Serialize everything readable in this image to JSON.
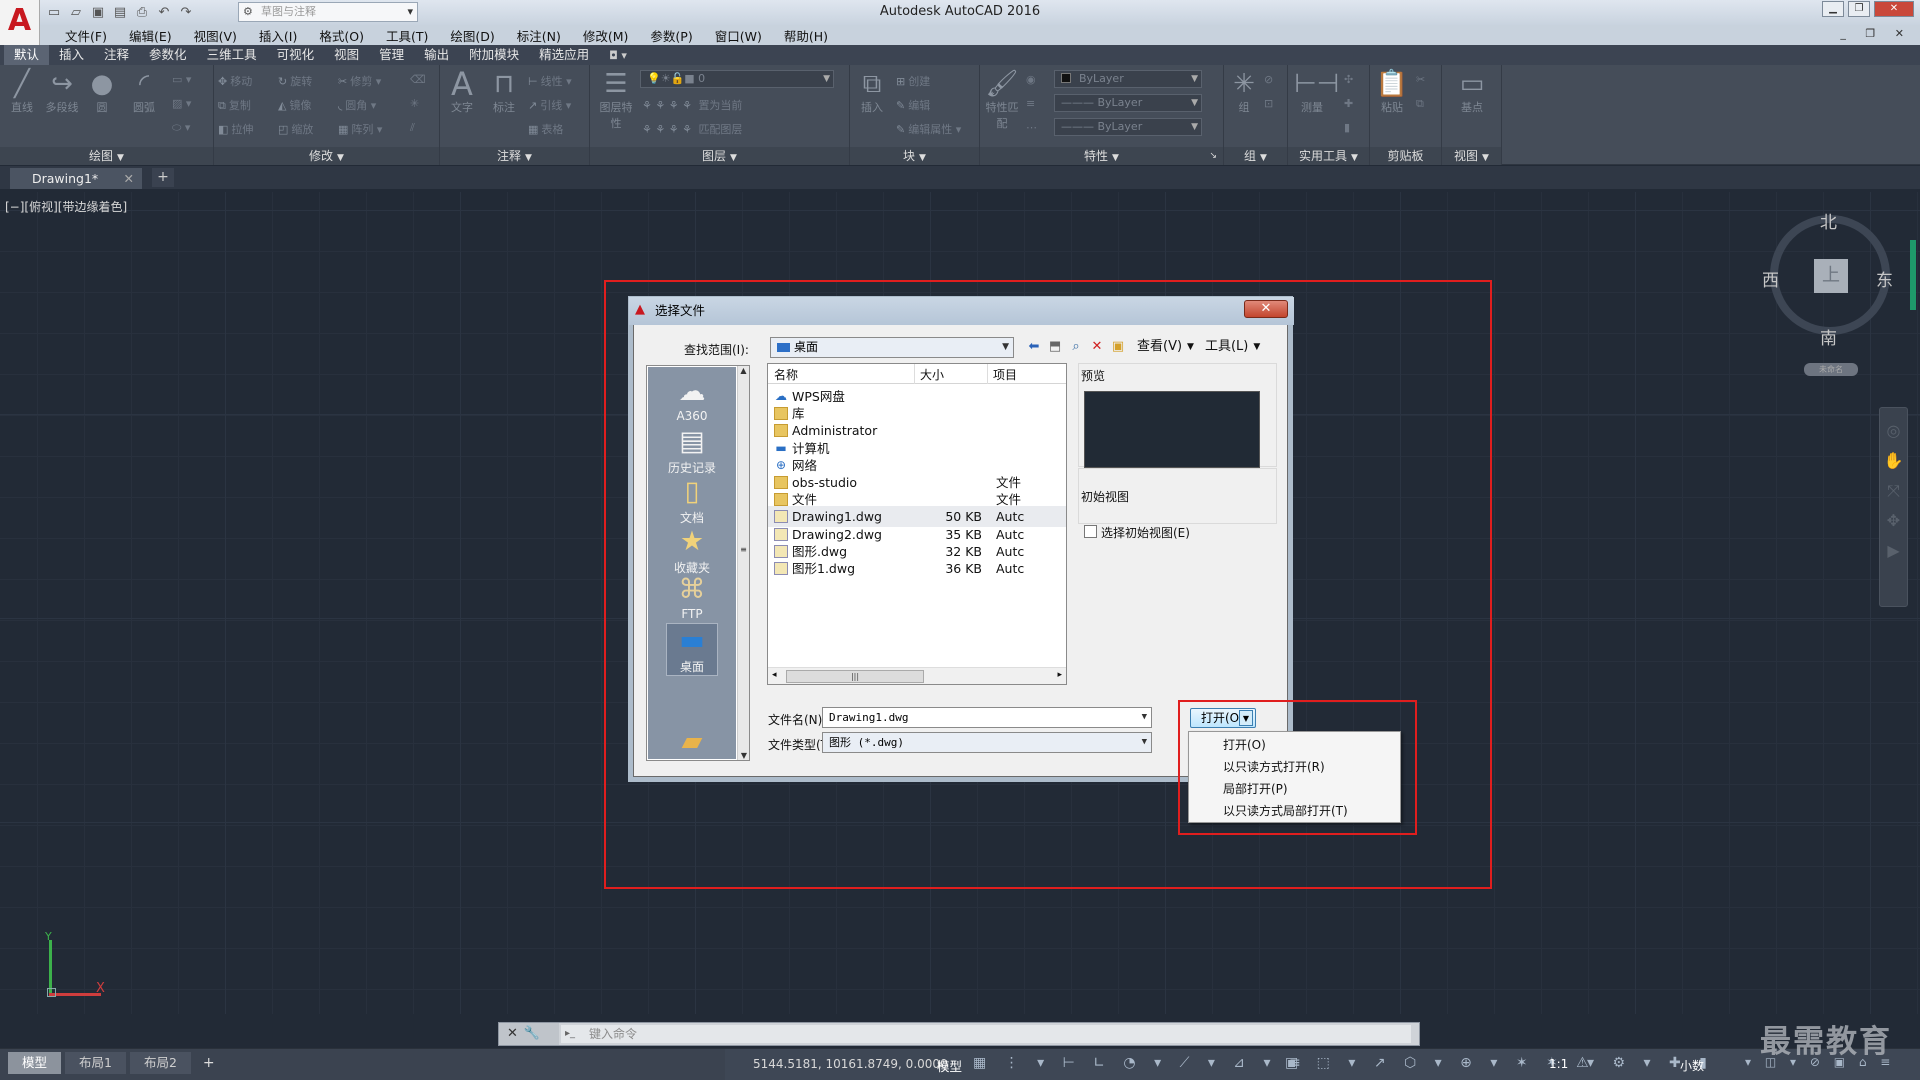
{
  "app": {
    "title": "Autodesk AutoCAD 2016",
    "workspace": "草图与注释",
    "logo_letter": "A"
  },
  "menus": [
    "文件(F)",
    "编辑(E)",
    "视图(V)",
    "插入(I)",
    "格式(O)",
    "工具(T)",
    "绘图(D)",
    "标注(N)",
    "修改(M)",
    "参数(P)",
    "窗口(W)",
    "帮助(H)"
  ],
  "ribbon_tabs": [
    "默认",
    "插入",
    "注释",
    "参数化",
    "三维工具",
    "可视化",
    "视图",
    "管理",
    "输出",
    "附加模块",
    "精选应用"
  ],
  "ribbon": {
    "panels": [
      "绘图",
      "修改",
      "注释",
      "图层",
      "块",
      "特性",
      "组",
      "实用工具",
      "剪贴板",
      "视图"
    ],
    "draw_tools": [
      "直线",
      "多段线",
      "圆",
      "圆弧"
    ],
    "modify_tools": [
      "移动",
      "旋转",
      "修剪",
      "复制",
      "镜像",
      "圆角",
      "拉伸",
      "缩放",
      "阵列"
    ],
    "annot_tools": [
      "文字",
      "标注",
      "线性",
      "引线",
      "表格"
    ],
    "layer_tools": [
      "图层特性",
      "置为当前",
      "匹配图层"
    ],
    "layer_current": "0",
    "block_tools": [
      "插入",
      "创建",
      "编辑",
      "编辑属性"
    ],
    "prop_tools": [
      "特性匹配"
    ],
    "bylayer": [
      "ByLayer",
      "ByLayer",
      "ByLayer"
    ],
    "util_tools": [
      "测量"
    ],
    "clip_tools": [
      "粘贴"
    ],
    "view_tools": [
      "基点"
    ]
  },
  "document": {
    "tab": "Drawing1*",
    "view_label": "[−][俯视][带边缘着色]"
  },
  "viewcube": {
    "north": "北",
    "south": "南",
    "east": "东",
    "west": "西",
    "face": "上",
    "ucs_name": "未命名"
  },
  "dialog": {
    "title": "选择文件",
    "look_in_label": "查找范围(I):",
    "look_in_value": "桌面",
    "views_label": "查看(V)",
    "tools_label": "工具(L)",
    "places": [
      "A360",
      "历史记录",
      "文档",
      "收藏夹",
      "FTP",
      "桌面"
    ],
    "columns": {
      "name": "名称",
      "size": "大小",
      "type": "项目"
    },
    "files": [
      {
        "name": "WPS网盘",
        "size": "",
        "type": "",
        "kind": "cloud"
      },
      {
        "name": "库",
        "size": "",
        "type": "",
        "kind": "folder"
      },
      {
        "name": "Administrator",
        "size": "",
        "type": "",
        "kind": "folder"
      },
      {
        "name": "计算机",
        "size": "",
        "type": "",
        "kind": "computer"
      },
      {
        "name": "网络",
        "size": "",
        "type": "",
        "kind": "network"
      },
      {
        "name": "obs-studio",
        "size": "",
        "type": "文件",
        "kind": "folder"
      },
      {
        "name": "文件",
        "size": "",
        "type": "文件",
        "kind": "folder"
      },
      {
        "name": "Drawing1.dwg",
        "size": "50 KB",
        "type": "Autc",
        "kind": "dwg"
      },
      {
        "name": "Drawing2.dwg",
        "size": "35 KB",
        "type": "Autc",
        "kind": "dwg"
      },
      {
        "name": "图形.dwg",
        "size": "32 KB",
        "type": "Autc",
        "kind": "dwg"
      },
      {
        "name": "图形1.dwg",
        "size": "36 KB",
        "type": "Autc",
        "kind": "dwg"
      }
    ],
    "selected_index": 7,
    "preview_label": "预览",
    "initial_view_label": "初始视图",
    "select_initial_view": "选择初始视图(E)",
    "file_name_label": "文件名(N):",
    "file_name_value": "Drawing1.dwg",
    "file_type_label": "文件类型(T):",
    "file_type_value": "图形 (*.dwg)",
    "open_button": "打开(O)",
    "close_glyph": "✕"
  },
  "open_menu": [
    "打开(O)",
    "以只读方式打开(R)",
    "局部打开(P)",
    "以只读方式局部打开(T)"
  ],
  "command_line": {
    "placeholder": "键入命令"
  },
  "ucs": {
    "x": "X",
    "y": "Y"
  },
  "status": {
    "layout_tabs": [
      "模型",
      "布局1",
      "布局2"
    ],
    "coords": "5144.5181, 10161.8749, 0.0000",
    "model": "模型",
    "scale": "1:1",
    "units": "小数"
  },
  "watermark": "最需教育",
  "colors": {
    "annotation_red": "#e01e1e",
    "canvas_bg": "#222a36",
    "autocad_red": "#c8181f"
  }
}
